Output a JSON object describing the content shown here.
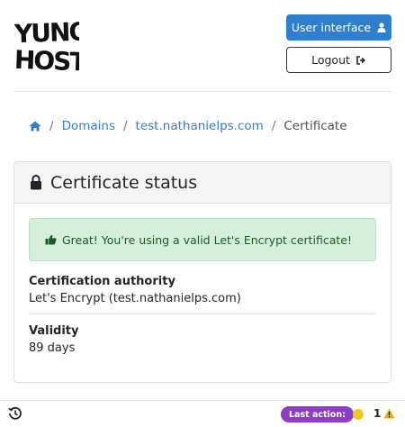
{
  "header": {
    "logo_lines": [
      "YUNO",
      "HOST"
    ],
    "user_interface_label": "User interface",
    "user_icon": "user-icon",
    "logout_label": "Logout",
    "logout_icon": "sign-out-icon"
  },
  "breadcrumb": {
    "home_icon": "home-icon",
    "items": [
      {
        "label": "Domains",
        "link": true
      },
      {
        "label": "test.nathanielps.com",
        "link": true
      },
      {
        "label": "Certificate",
        "link": false
      }
    ],
    "separator": "/"
  },
  "card": {
    "icon": "lock-icon",
    "title": "Certificate status",
    "alert": {
      "icon": "thumbs-up-icon",
      "text": "Great! You're using a valid Let's Encrypt certificate!"
    },
    "fields": [
      {
        "label": "Certification authority",
        "value": "Let's Encrypt (test.nathanielps.com)"
      },
      {
        "label": "Validity",
        "value": "89 days"
      }
    ]
  },
  "footer": {
    "history_icon": "history-icon",
    "last_action_label": "Last action:",
    "status_color": "#f3c623",
    "warning_count": "1",
    "warning_icon": "warning-icon"
  },
  "colors": {
    "primary": "#2f7fd0",
    "success_bg": "#d6efdb",
    "success_text": "#1c5a2a",
    "badge": "#8e3cc7",
    "warning": "#f0ad1c"
  }
}
